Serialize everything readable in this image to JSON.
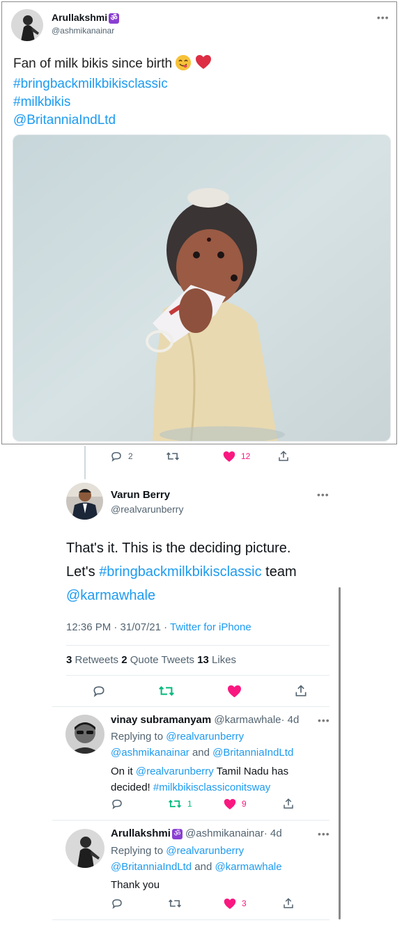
{
  "tweet1": {
    "name": "Arullakshmi",
    "badge": "ॐ",
    "handle": "@ashmikanainar",
    "more": "•••",
    "lines": [
      "Fan of milk bikis since birth",
      "#bringbackmilkbikisclassic",
      "#milkbikis",
      "@BritanniaIndLtd"
    ],
    "reply_count": "2",
    "like_count": "12"
  },
  "tweet2": {
    "name": "Varun Berry",
    "handle": "@realvarunberry",
    "more": "•••",
    "line1": "That's it. This is the deciding picture.",
    "line2_pre": "Let's ",
    "line2_tag": "#bringbackmilkbikisclassic",
    "line2_post": " team",
    "line3": "@karmawhale",
    "time": "12:36 PM · 31/07/21 · ",
    "source": "Twitter for iPhone",
    "retweets_num": "3",
    "retweets_label": " Retweets ",
    "quotes_num": "2",
    "quotes_label": " Quote Tweets ",
    "likes_num": "13",
    "likes_label": " Likes"
  },
  "reply1": {
    "name": "vinay subramanyam",
    "handle": "@karmawhale",
    "age": "· 4d",
    "more": "•••",
    "replying_label": "Replying to ",
    "replying_1": "@realvarunberry",
    "replying_2": "@ashmikanainar",
    "and": " and ",
    "replying_3": "@BritanniaIndLtd",
    "text_1a": "On it ",
    "text_1b": "@realvarunberry",
    "text_1c": " Tamil Nadu has",
    "text_2a": "decided! ",
    "text_2b": "#milkbikisclassiconitsway",
    "retweet_count": "1",
    "like_count": "9"
  },
  "reply2": {
    "name": "Arullakshmi",
    "badge": "ॐ",
    "handle": "@ashmikanainar",
    "age": "· 4d",
    "more": "•••",
    "replying_label": "Replying to ",
    "replying_1": "@realvarunberry",
    "replying_2": "@BritanniaIndLtd",
    "and": " and ",
    "replying_3": "@karmawhale",
    "text": "Thank you",
    "like_count": "3"
  },
  "colors": {
    "link": "#1d9bf0",
    "like": "#f91880",
    "retweet": "#00ba7c",
    "muted": "#536471"
  }
}
